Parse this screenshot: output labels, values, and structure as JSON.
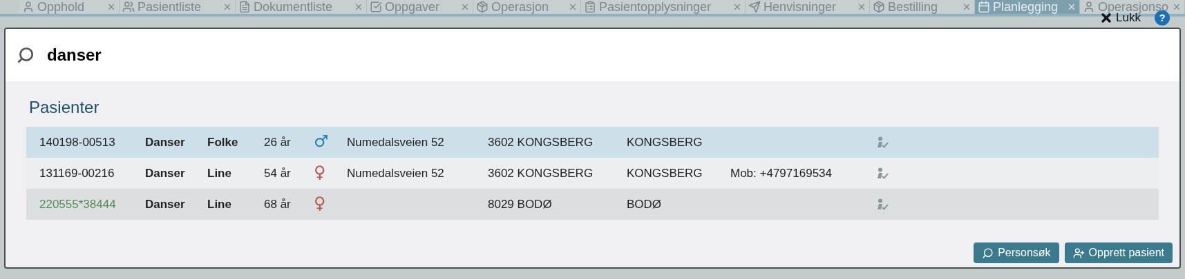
{
  "tabs": [
    {
      "label": "Opphold",
      "selected": false
    },
    {
      "label": "Pasientliste",
      "selected": false
    },
    {
      "label": "Dokumentliste",
      "selected": false
    },
    {
      "label": "Oppgaver",
      "selected": false
    },
    {
      "label": "Operasjon",
      "selected": false
    },
    {
      "label": "Pasientopplysninger",
      "selected": false
    },
    {
      "label": "Henvisninger",
      "selected": false
    },
    {
      "label": "Bestilling",
      "selected": false
    },
    {
      "label": "Planlegging",
      "selected": true
    },
    {
      "label": "Operasjonso",
      "selected": false
    }
  ],
  "close_label": "Lukk",
  "help_label": "?",
  "search": {
    "value": "danser"
  },
  "section_title": "Pasienter",
  "patients": [
    {
      "id": "140198-00513",
      "temporary": false,
      "last_name": "Danser",
      "first_name": "Folke",
      "age": "26 år",
      "color": "#1f7fb0",
      "gender_symbol": "♂",
      "address": "Numedalsveien 52",
      "postal": "3602 KONGSBERG",
      "municipality": "KONGSBERG",
      "selected": true
    },
    {
      "id": "131169-00216",
      "temporary": false,
      "last_name": "Danser",
      "first_name": "Line",
      "age": "54 år",
      "color": "#c0504d",
      "gender_symbol": "♀",
      "address": "Numedalsveien 52",
      "postal": "3602 KONGSBERG",
      "municipality": "KONGSBERG",
      "phone": "Mob: +4797169534",
      "selected": false
    },
    {
      "id": "220555*38444",
      "temporary": true,
      "last_name": "Danser",
      "first_name": "Line",
      "age": "68 år",
      "color": "#c0504d",
      "gender_symbol": "♀",
      "postal": "8029 BODØ",
      "municipality": "BODØ",
      "selected": false
    }
  ],
  "buttons": [
    {
      "label": "Personsøk",
      "kind": "search"
    },
    {
      "label": "Opprett pasient",
      "kind": "create"
    }
  ]
}
